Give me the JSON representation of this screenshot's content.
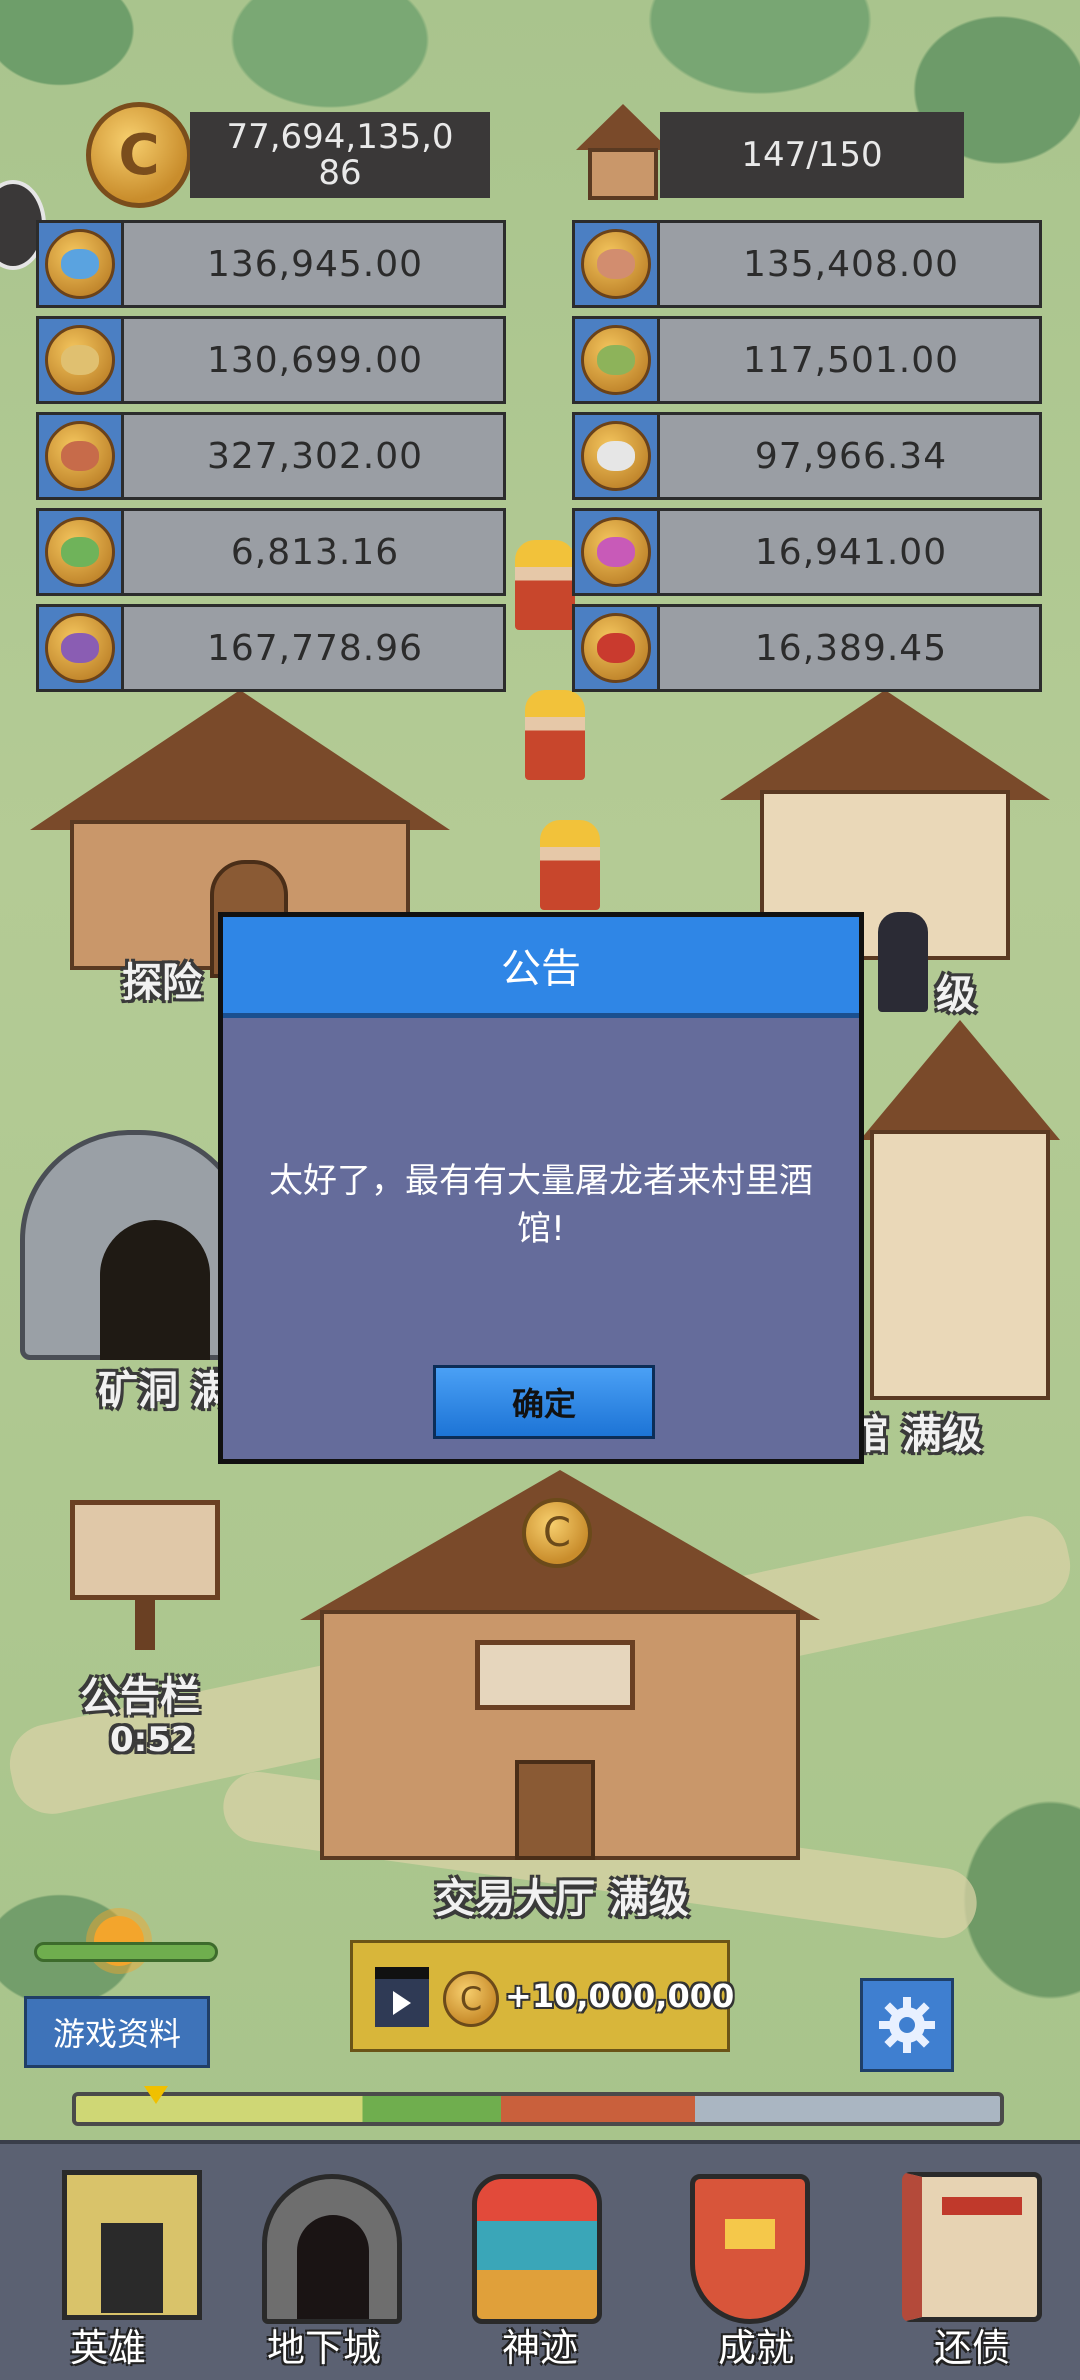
{
  "top_bar": {
    "gold_amount": "77,694,135,0\n86",
    "coin_symbol": "C",
    "population": "147/150"
  },
  "resources": {
    "left": [
      {
        "icon": "blue-slime-coin-icon",
        "value": "136,945.00",
        "color": "#5aa3e0"
      },
      {
        "icon": "skull-coin-icon",
        "value": "130,699.00",
        "color": "#e0c070"
      },
      {
        "icon": "red-beast-coin-icon",
        "value": "327,302.00",
        "color": "#c76b4a"
      },
      {
        "icon": "green-goblin-coin-icon",
        "value": "6,813.16",
        "color": "#6fb35a"
      },
      {
        "icon": "purple-bat-coin-icon",
        "value": "167,778.96",
        "color": "#8a5db3"
      }
    ],
    "right": [
      {
        "icon": "zombie-coin-icon",
        "value": "135,408.00",
        "color": "#d28d6f"
      },
      {
        "icon": "orc-coin-icon",
        "value": "117,501.00",
        "color": "#8db35a"
      },
      {
        "icon": "wolf-coin-icon",
        "value": "97,966.34",
        "color": "#e6e6e6"
      },
      {
        "icon": "mushroom-coin-icon",
        "value": "16,941.00",
        "color": "#c85ab8"
      },
      {
        "icon": "dragon-coin-icon",
        "value": "16,389.45",
        "color": "#c93a2e"
      }
    ]
  },
  "buildings": {
    "adventure_label": "探险",
    "left_mid_label": "级",
    "mine_label": "矿洞 满",
    "right_bottom_label": "馆 满级",
    "notice_board_label": "公告栏",
    "notice_board_timer": "0:52",
    "trade_hall_label": "交易大厅 满级"
  },
  "modal": {
    "title": "公告",
    "message": "太好了，最有有大量屠龙者来村里酒馆!",
    "confirm_label": "确定"
  },
  "controls": {
    "game_info_label": "游戏资料",
    "video_reward": "+10,000,000"
  },
  "nav": {
    "items": [
      {
        "label": "英雄",
        "icon": "castle-tower-icon"
      },
      {
        "label": "地下城",
        "icon": "dungeon-gate-icon"
      },
      {
        "label": "神迹",
        "icon": "totem-statue-icon"
      },
      {
        "label": "成就",
        "icon": "crown-shield-icon"
      },
      {
        "label": "还债",
        "icon": "ledger-book-icon"
      }
    ]
  },
  "colors": {
    "modal_header": "#2f86e6",
    "modal_body": "#656c9b",
    "resource_badge": "#4b7fc3",
    "nav_bar": "#5b6172"
  }
}
